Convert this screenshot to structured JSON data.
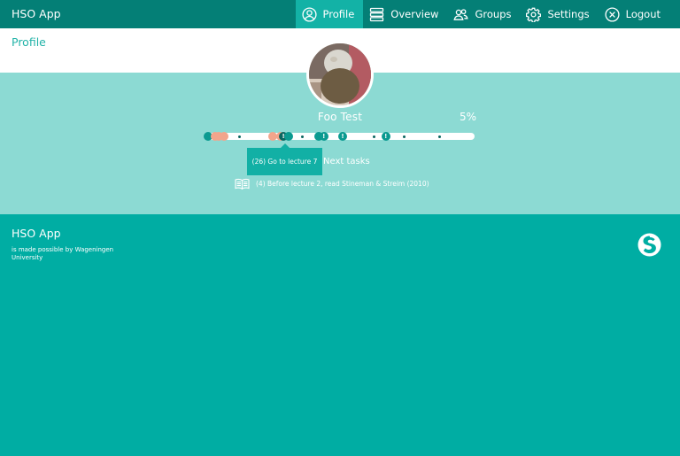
{
  "app": {
    "title": "HSO App"
  },
  "nav": {
    "items": [
      {
        "label": "Profile",
        "icon": "user-circle-icon",
        "active": true
      },
      {
        "label": "Overview",
        "icon": "list-icon",
        "active": false
      },
      {
        "label": "Groups",
        "icon": "users-icon",
        "active": false
      },
      {
        "label": "Settings",
        "icon": "gear-icon",
        "active": false
      },
      {
        "label": "Logout",
        "icon": "close-circle-icon",
        "active": false
      }
    ]
  },
  "page": {
    "title": "Profile"
  },
  "profile": {
    "name": "Foo Test",
    "progress_label": "5%",
    "progress": 0.05
  },
  "timeline": {
    "tooltip": "(26) Go to lecture 7",
    "markers": [
      {
        "pos": 0.01,
        "kind": "teal"
      },
      {
        "pos": 0.035,
        "kind": "salmon"
      },
      {
        "pos": 0.05,
        "kind": "salmon"
      },
      {
        "pos": 0.07,
        "kind": "salmon"
      },
      {
        "pos": 0.25,
        "kind": "salmon"
      },
      {
        "pos": 0.28,
        "kind": "salmon"
      },
      {
        "pos": 0.29,
        "kind": "dark",
        "label": "!"
      },
      {
        "pos": 0.31,
        "kind": "teal"
      },
      {
        "pos": 0.42,
        "kind": "teal"
      },
      {
        "pos": 0.44,
        "kind": "teal",
        "label": "!"
      },
      {
        "pos": 0.51,
        "kind": "teal",
        "label": "!"
      },
      {
        "pos": 0.67,
        "kind": "teal",
        "label": "!"
      }
    ],
    "dots": [
      0.125,
      0.36,
      0.625,
      0.74,
      0.87
    ]
  },
  "tasks": {
    "heading": "Next tasks",
    "items": [
      {
        "icon": "book-icon",
        "text": "(4) Before lecture 2, read Stineman & Streim (2010)"
      }
    ]
  },
  "footer": {
    "title": "HSO App",
    "credit": "is made possible by Wageningen University",
    "logo": "university-logo-icon"
  },
  "colors": {
    "topbar": "#047f76",
    "active_tab": "#13b2a6",
    "band": "#8cdad3",
    "footer": "#00ada3",
    "accent_text": "#22b3a8",
    "salmon": "#f2a58c"
  }
}
